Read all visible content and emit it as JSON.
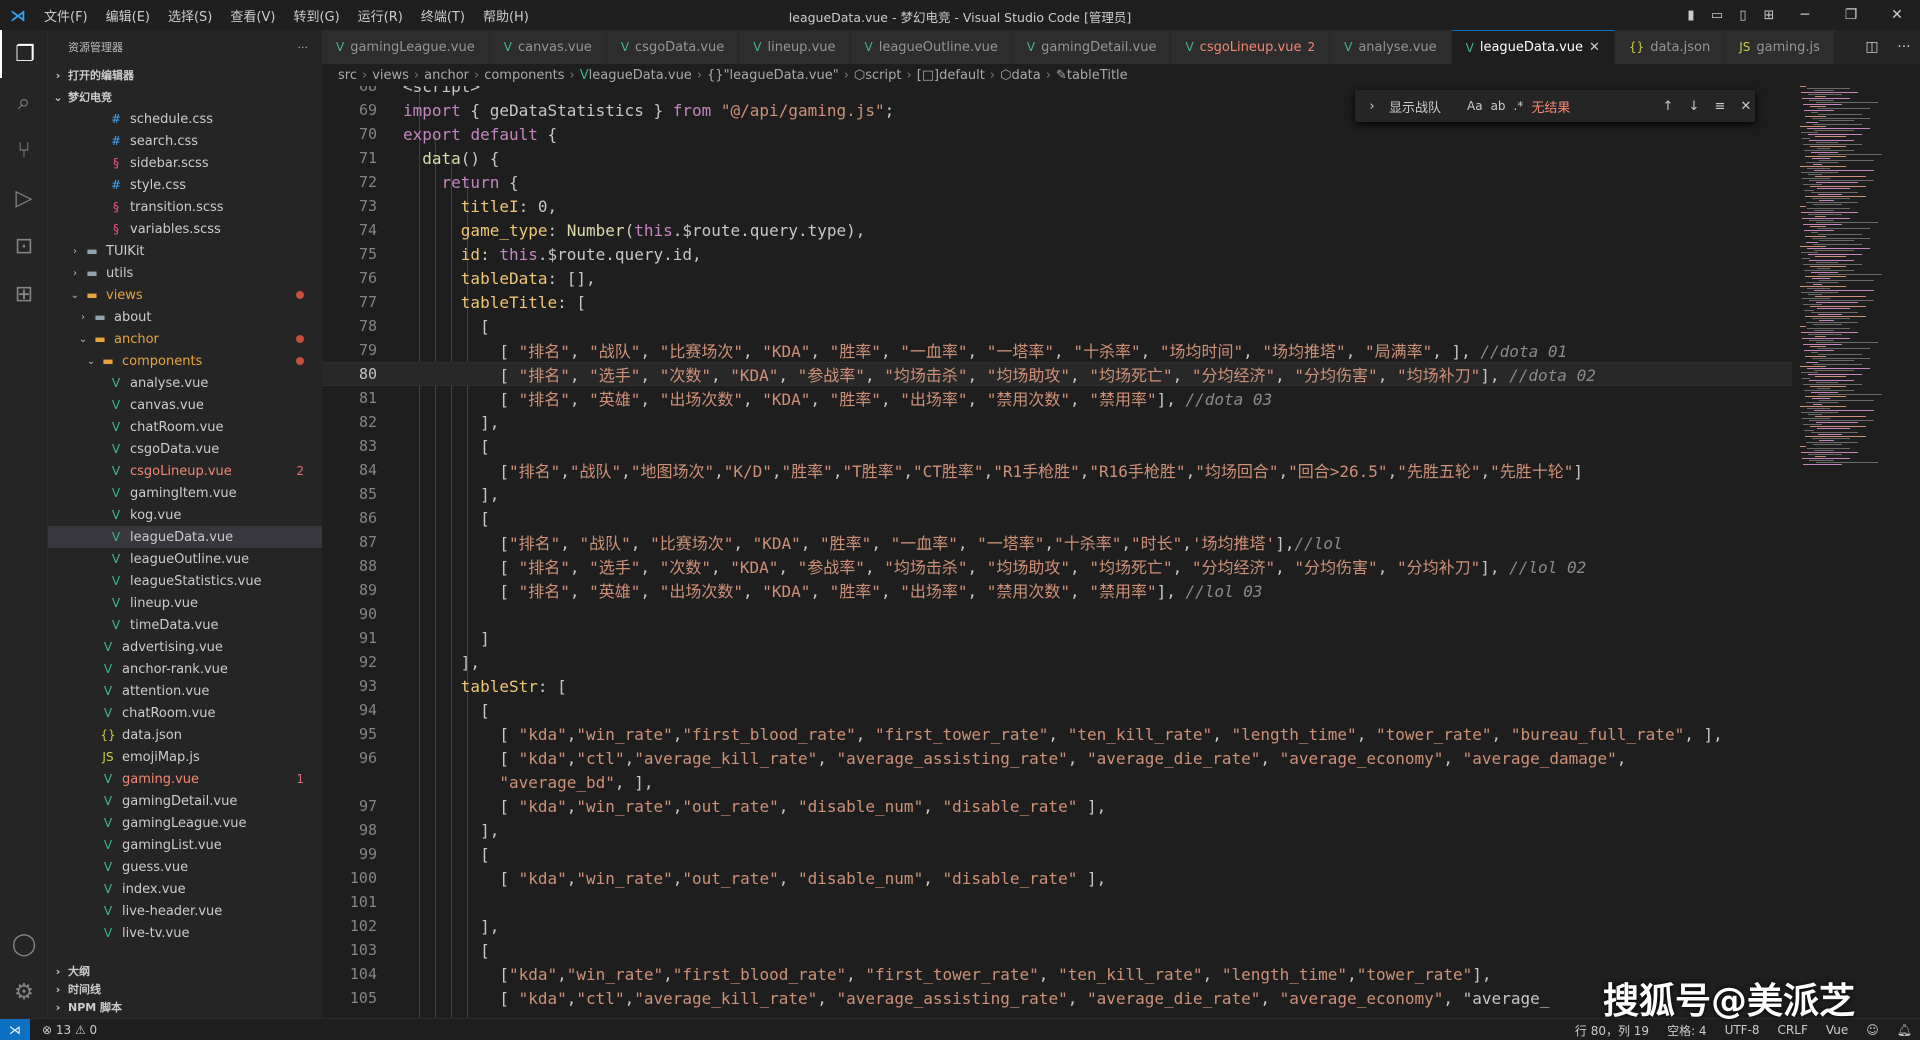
{
  "window": {
    "title": "leagueData.vue - 梦幻电竞 - Visual Studio Code [管理员]",
    "menu": [
      "文件(F)",
      "编辑(E)",
      "选择(S)",
      "查看(V)",
      "转到(G)",
      "运行(R)",
      "终端(T)",
      "帮助(H)"
    ]
  },
  "sidebar": {
    "title": "资源管理器",
    "open_editors": "打开的编辑器",
    "workspace": "梦幻电竞",
    "rows": [
      {
        "label": "schedule.css",
        "icon": "css"
      },
      {
        "label": "search.css",
        "icon": "css"
      },
      {
        "label": "sidebar.scss",
        "icon": "scss"
      },
      {
        "label": "style.css",
        "icon": "css"
      },
      {
        "label": "transition.scss",
        "icon": "scss"
      },
      {
        "label": "variables.scss",
        "icon": "scss"
      },
      {
        "label": "TUIKit",
        "icon": "folder"
      },
      {
        "label": "utils",
        "icon": "folder"
      },
      {
        "label": "views",
        "icon": "folder-open"
      },
      {
        "label": "about",
        "icon": "folder"
      },
      {
        "label": "anchor",
        "icon": "folder-open"
      },
      {
        "label": "components",
        "icon": "folder-open"
      },
      {
        "label": "analyse.vue",
        "icon": "vue"
      },
      {
        "label": "canvas.vue",
        "icon": "vue"
      },
      {
        "label": "chatRoom.vue",
        "icon": "vue"
      },
      {
        "label": "csgoData.vue",
        "icon": "vue"
      },
      {
        "label": "csgoLineup.vue",
        "icon": "vue",
        "badge": "2"
      },
      {
        "label": "gamingItem.vue",
        "icon": "vue"
      },
      {
        "label": "kog.vue",
        "icon": "vue"
      },
      {
        "label": "leagueData.vue",
        "icon": "vue"
      },
      {
        "label": "leagueOutline.vue",
        "icon": "vue"
      },
      {
        "label": "leagueStatistics.vue",
        "icon": "vue"
      },
      {
        "label": "lineup.vue",
        "icon": "vue"
      },
      {
        "label": "timeData.vue",
        "icon": "vue"
      },
      {
        "label": "advertising.vue",
        "icon": "vue"
      },
      {
        "label": "anchor-rank.vue",
        "icon": "vue"
      },
      {
        "label": "attention.vue",
        "icon": "vue"
      },
      {
        "label": "chatRoom.vue",
        "icon": "vue"
      },
      {
        "label": "data.json",
        "icon": "json"
      },
      {
        "label": "emojiMap.js",
        "icon": "js"
      },
      {
        "label": "gaming.vue",
        "icon": "vue",
        "badge": "1"
      },
      {
        "label": "gamingDetail.vue",
        "icon": "vue"
      },
      {
        "label": "gamingLeague.vue",
        "icon": "vue"
      },
      {
        "label": "gamingList.vue",
        "icon": "vue"
      },
      {
        "label": "guess.vue",
        "icon": "vue"
      },
      {
        "label": "index.vue",
        "icon": "vue"
      },
      {
        "label": "live-header.vue",
        "icon": "vue"
      },
      {
        "label": "live-tv.vue",
        "icon": "vue"
      }
    ],
    "sections": [
      "大纲",
      "时间线",
      "NPM 脚本"
    ]
  },
  "tabs": [
    {
      "label": "gamingLeague.vue",
      "icon": "vue"
    },
    {
      "label": "canvas.vue",
      "icon": "vue"
    },
    {
      "label": "csgoData.vue",
      "icon": "vue"
    },
    {
      "label": "lineup.vue",
      "icon": "vue"
    },
    {
      "label": "leagueOutline.vue",
      "icon": "vue"
    },
    {
      "label": "gamingDetail.vue",
      "icon": "vue"
    },
    {
      "label": "csgoLineup.vue",
      "icon": "vue",
      "badge": "2"
    },
    {
      "label": "analyse.vue",
      "icon": "vue"
    },
    {
      "label": "leagueData.vue",
      "icon": "vue",
      "active": true
    },
    {
      "label": "data.json",
      "icon": "json"
    },
    {
      "label": "gaming.js",
      "icon": "js"
    }
  ],
  "breadcrumb": [
    "src",
    "views",
    "anchor",
    "components",
    "leagueData.vue",
    "\"leagueData.vue\"",
    "script",
    "default",
    "data",
    "tableTitle"
  ],
  "find_widget": {
    "query": "显示战队",
    "opt_case": "Aa",
    "opt_word": "ab",
    "opt_regex": ".*",
    "result": "无结果"
  },
  "editor": {
    "current_line": 80,
    "lines": [
      {
        "n": "68",
        "t": "<script>"
      },
      {
        "n": "69",
        "t": "import { geDataStatistics } from \"@/api/gaming.js\";"
      },
      {
        "n": "70",
        "t": "export default {"
      },
      {
        "n": "71",
        "t": "  data() {"
      },
      {
        "n": "72",
        "t": "    return {"
      },
      {
        "n": "73",
        "t": "      titleI: 0,"
      },
      {
        "n": "74",
        "t": "      game_type: Number(this.$route.query.type),"
      },
      {
        "n": "75",
        "t": "      id: this.$route.query.id,"
      },
      {
        "n": "76",
        "t": "      tableData: [],"
      },
      {
        "n": "77",
        "t": "      tableTitle: ["
      },
      {
        "n": "78",
        "t": "        ["
      },
      {
        "n": "79",
        "t": "          [ \"排名\", \"战队\", \"比赛场次\", \"KDA\", \"胜率\", \"一血率\", \"一塔率\", \"十杀率\", \"场均时间\", \"场均推塔\", \"局满率\", ], //dota 01"
      },
      {
        "n": "80",
        "t": "          [ \"排名\", \"选手\", \"次数\", \"KDA\", \"参战率\", \"均场击杀\", \"均场助攻\", \"均场死亡\", \"分均经济\", \"分均伤害\", \"均场补刀\"], //dota 02"
      },
      {
        "n": "81",
        "t": "          [ \"排名\", \"英雄\", \"出场次数\", \"KDA\", \"胜率\", \"出场率\", \"禁用次数\", \"禁用率\"], //dota 03"
      },
      {
        "n": "82",
        "t": "        ],"
      },
      {
        "n": "83",
        "t": "        ["
      },
      {
        "n": "84",
        "t": "          [\"排名\",\"战队\",\"地图场次\",\"K/D\",\"胜率\",\"T胜率\",\"CT胜率\",\"R1手枪胜\",\"R16手枪胜\",\"均场回合\",\"回合>26.5\",\"先胜五轮\",\"先胜十轮\"]"
      },
      {
        "n": "85",
        "t": "        ],"
      },
      {
        "n": "86",
        "t": "        ["
      },
      {
        "n": "87",
        "t": "          [\"排名\", \"战队\", \"比赛场次\", \"KDA\", \"胜率\", \"一血率\", \"一塔率\",\"十杀率\",\"时长\",'场均推塔'],//lol"
      },
      {
        "n": "88",
        "t": "          [ \"排名\", \"选手\", \"次数\", \"KDA\", \"参战率\", \"均场击杀\", \"均场助攻\", \"均场死亡\", \"分均经济\", \"分均伤害\", \"分均补刀\"], //lol 02"
      },
      {
        "n": "89",
        "t": "          [ \"排名\", \"英雄\", \"出场次数\", \"KDA\", \"胜率\", \"出场率\", \"禁用次数\", \"禁用率\"], //lol 03"
      },
      {
        "n": "90",
        "t": ""
      },
      {
        "n": "91",
        "t": "        ]"
      },
      {
        "n": "92",
        "t": "      ],"
      },
      {
        "n": "93",
        "t": "      tableStr: ["
      },
      {
        "n": "94",
        "t": "        ["
      },
      {
        "n": "95",
        "t": "          [ \"kda\",\"win_rate\",\"first_blood_rate\", \"first_tower_rate\", \"ten_kill_rate\", \"length_time\", \"tower_rate\", \"bureau_full_rate\", ],"
      },
      {
        "n": "96",
        "t": "          [ \"kda\",\"ctl\",\"average_kill_rate\", \"average_assisting_rate\", \"average_die_rate\", \"average_economy\", \"average_damage\","
      },
      {
        "n": "",
        "t": "          \"average_bd\", ],"
      },
      {
        "n": "97",
        "t": "          [ \"kda\",\"win_rate\",\"out_rate\", \"disable_num\", \"disable_rate\" ],"
      },
      {
        "n": "98",
        "t": "        ],"
      },
      {
        "n": "99",
        "t": "        ["
      },
      {
        "n": "100",
        "t": "          [ \"kda\",\"win_rate\",\"out_rate\", \"disable_num\", \"disable_rate\" ],"
      },
      {
        "n": "101",
        "t": ""
      },
      {
        "n": "102",
        "t": "        ],"
      },
      {
        "n": "103",
        "t": "        ["
      },
      {
        "n": "104",
        "t": "          [\"kda\",\"win_rate\",\"first_blood_rate\", \"first_tower_rate\", \"ten_kill_rate\", \"length_time\",\"tower_rate\"],"
      },
      {
        "n": "105",
        "t": "          [ \"kda\",\"ctl\",\"average_kill_rate\", \"average_assisting_rate\", \"average_die_rate\", \"average_economy\", \"average_"
      }
    ]
  },
  "statusbar": {
    "problems": "⊗ 13 ⚠ 0",
    "cursor": "行 80，列 19",
    "spaces": "空格: 4",
    "encoding": "UTF-8",
    "eol": "CRLF",
    "language": "Vue"
  },
  "watermark": "搜狐号@美派芝",
  "colors": {
    "accent": "#0e70c0",
    "vue": "#42b883",
    "error": "#f48771"
  }
}
